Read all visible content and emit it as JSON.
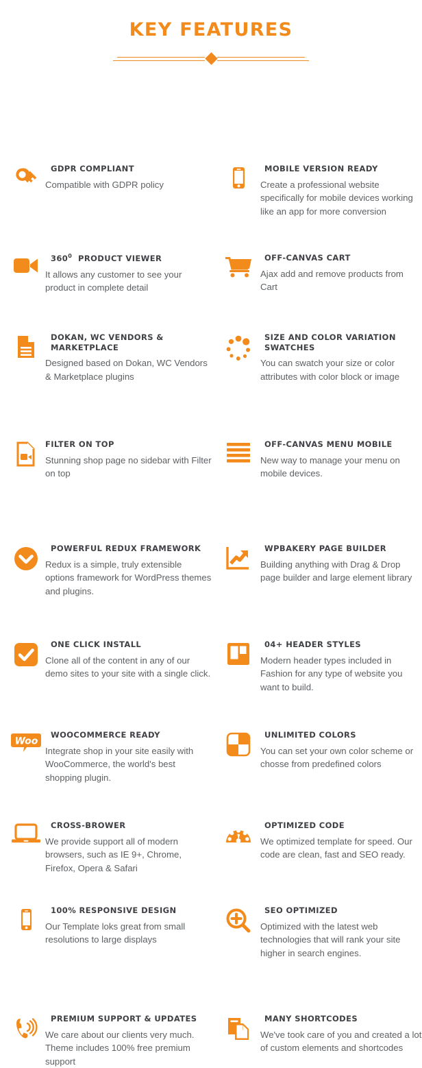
{
  "header": {
    "title": "KEY FEATURES",
    "divider_icon": "diamond-divider"
  },
  "colors": {
    "accent": "#f28b1c",
    "title_text": "#3f4145",
    "body_text": "#5d6063",
    "background": "#ffffff"
  },
  "features": [
    {
      "icon": "key-icon",
      "title": "GDPR COMPLIANT",
      "desc": "Compatible with GDPR policy"
    },
    {
      "icon": "mobile-phone-icon",
      "title": "MOBILE VERSION READY",
      "desc": "Create a professional website specifically for mobile devices working like an app for more conversion"
    },
    {
      "icon": "video-camera-icon",
      "title_prefix": "360",
      "title_sup": "0",
      "title": "PRODUCT VIEWER",
      "desc": "It allows any customer to see your product in complete detail"
    },
    {
      "icon": "shopping-cart-icon",
      "title": "OFF-CANVAS CART",
      "desc": "Ajax add and remove products from Cart"
    },
    {
      "icon": "document-lines-icon",
      "title": "DOKAN, WC VENDORS & MARKETPLACE",
      "desc": "Designed based on Dokan, WC Vendors & Marketplace plugins"
    },
    {
      "icon": "color-swatch-dots-icon",
      "title": "SIZE AND COLOR VARIATION SWATCHES",
      "desc": "You can swatch your size or color attributes with color block or image"
    },
    {
      "icon": "document-video-icon",
      "title": "FILTER ON TOP",
      "desc": "Stunning shop page no sidebar with Filter on top"
    },
    {
      "icon": "hamburger-menu-icon",
      "title": "OFF-CANVAS MENU MOBILE",
      "desc": "New way to manage your menu on mobile devices."
    },
    {
      "icon": "chevron-down-circle-icon",
      "title": "POWERFUL REDUX FRAMEWORK",
      "desc": "Redux is a simple, truly extensible options framework for WordPress themes and plugins."
    },
    {
      "icon": "growth-chart-icon",
      "title": "WPBAKERY PAGE BUILDER",
      "desc": "Building anything with Drag & Drop page builder and large element library"
    },
    {
      "icon": "checkmark-square-icon",
      "title": "ONE CLICK INSTALL",
      "desc": "Clone all of the content in any of our demo sites to your site with a single click."
    },
    {
      "icon": "header-layout-icon",
      "title": "04+ HEADER STYLES",
      "desc": "Modern header types included in Fashion for any type of website you want to build."
    },
    {
      "icon": "woocommerce-logo-icon",
      "title": "WOOCOMMERCE READY",
      "desc": "Integrate shop in your site easily with WooCommerce, the world's best shopping plugin."
    },
    {
      "icon": "checkerboard-colors-icon",
      "title": "UNLIMITED COLORS",
      "desc": "You can set your own color scheme or chosse from predefined colors"
    },
    {
      "icon": "laptop-icon",
      "title": "CROSS-BROWER",
      "desc": "We provide support all of modern browsers, such as IE 9+, Chrome, Firefox, Opera & Safari"
    },
    {
      "icon": "speedometer-icon",
      "title": "OPTIMIZED CODE",
      "desc": "We optimized template for speed. Our code are clean, fast and SEO ready."
    },
    {
      "icon": "smartphone-icon",
      "title": "100% RESPONSIVE DESIGN",
      "desc": "Our Template loks great from small resolutions to large displays"
    },
    {
      "icon": "magnifier-plus-icon",
      "title": "SEO OPTIMIZED",
      "desc": "Optimized with the latest web technologies that will rank your site higher in search engines."
    },
    {
      "icon": "phone-ringing-icon",
      "title": "PREMIUM SUPPORT & UPDATES",
      "desc": "We care about our clients very much. Theme includes 100% free premium support"
    },
    {
      "icon": "copy-documents-icon",
      "title": "MANY SHORTCODES",
      "desc": "We've took care of you and created a lot of custom elements and shortcodes"
    }
  ]
}
